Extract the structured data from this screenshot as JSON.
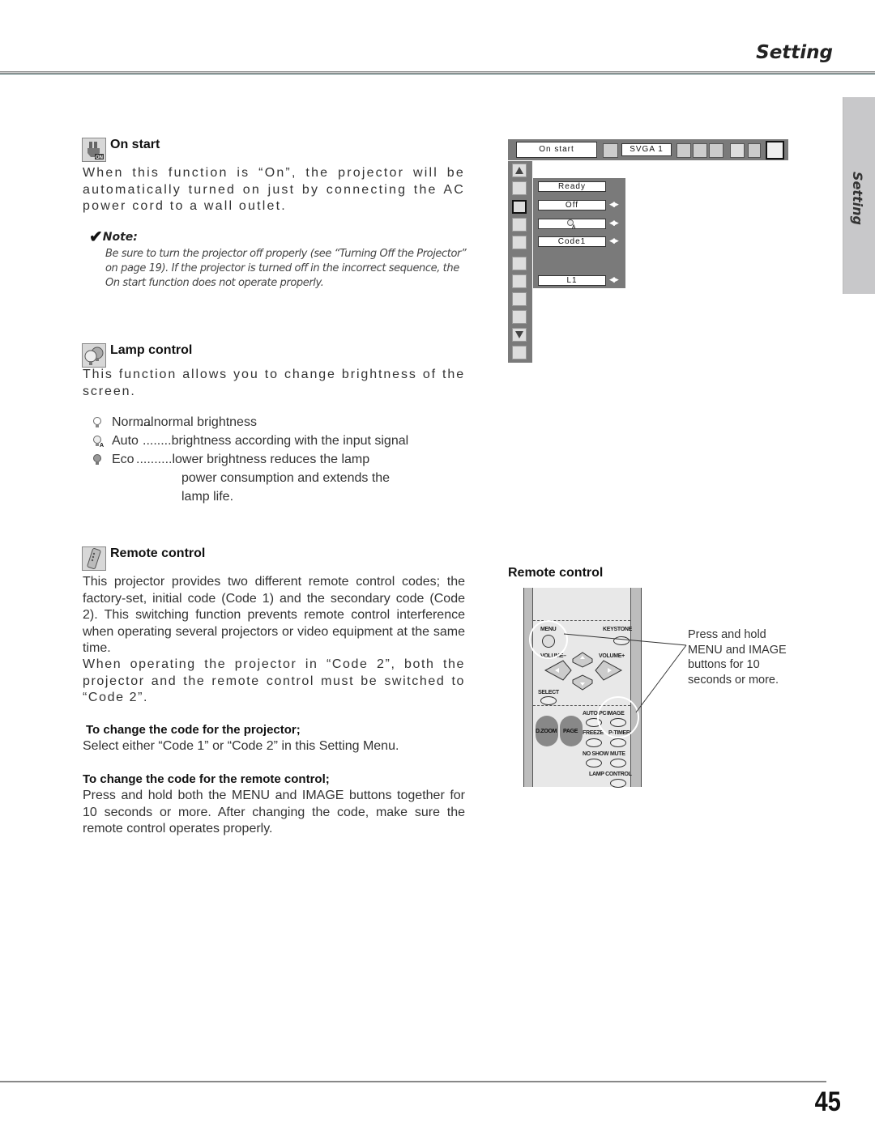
{
  "header": {
    "section_title": "Setting"
  },
  "side_tab": {
    "label": "Setting"
  },
  "on_start": {
    "title": "On start",
    "icon": "on-start-plug-icon",
    "body": "When this function is “On”, the projector will be automatically turned on just by connecting the AC power cord to a wall outlet.",
    "note_label": "Note:",
    "note_text": "Be sure to turn the projector off properly (see “Turning Off the Projector” on page 19).  If the projector is turned off in the incorrect sequence, the On start function does not operate properly."
  },
  "lamp_control": {
    "title": "Lamp control",
    "icon": "lamp-bulbs-icon",
    "body": "This function allows you to change brightness of the screen.",
    "modes": [
      {
        "icon": "lamp-normal-icon",
        "name": "Normal",
        "desc": "....normal brightness"
      },
      {
        "icon": "lamp-auto-icon",
        "name": "Auto",
        "desc": "........brightness according with the input  signal"
      },
      {
        "icon": "lamp-eco-icon",
        "name": "Eco",
        "desc": "..........lower brightness reduces the lamp",
        "desc2": "power consumption and extends the",
        "desc3": "lamp life."
      }
    ]
  },
  "remote_control": {
    "title": "Remote control",
    "icon": "remote-control-icon",
    "body1": "This projector provides two different remote control codes; the factory-set, initial code (Code 1) and the secondary code (Code 2).  This switching function prevents remote control interference when operating several projectors or video equipment at the same time.",
    "body2": "When operating the projector in “Code 2”,  both the projector and the remote control must be switched to “Code 2”.",
    "projector_head": "To change the code for the projector;",
    "projector_text": "Select either “Code 1” or “Code 2” in this Setting Menu.",
    "remote_head": "To change the code for the remote control;",
    "remote_text": "Press and hold both the MENU and IMAGE buttons together for 10 seconds or more.  After changing the code, make sure the  remote control operates properly."
  },
  "osd_menu": {
    "current_item": "On start",
    "signal": "SVGA 1",
    "fields": [
      "Ready",
      "Off",
      "",
      "Code1",
      "L1"
    ]
  },
  "remote_figure": {
    "caption": "Remote control",
    "callout": "Press and hold MENU and IMAGE buttons for 10 seconds or more.",
    "labels": {
      "menu": "MENU",
      "keystone": "KEYSTONE",
      "volume_minus": "VOLUME–",
      "volume_plus": "VOLUME+",
      "select": "SELECT",
      "auto_pc": "AUTO PC",
      "image": "IMAGE",
      "dzoom": "D.ZOOM",
      "page": "PAGE",
      "freeze": "FREEZE",
      "ptimer": "P-TIMER",
      "no_show": "NO SHOW",
      "mute": "MUTE",
      "lamp_control": "LAMP CONTROL"
    }
  },
  "footer": {
    "page_number": "45"
  }
}
